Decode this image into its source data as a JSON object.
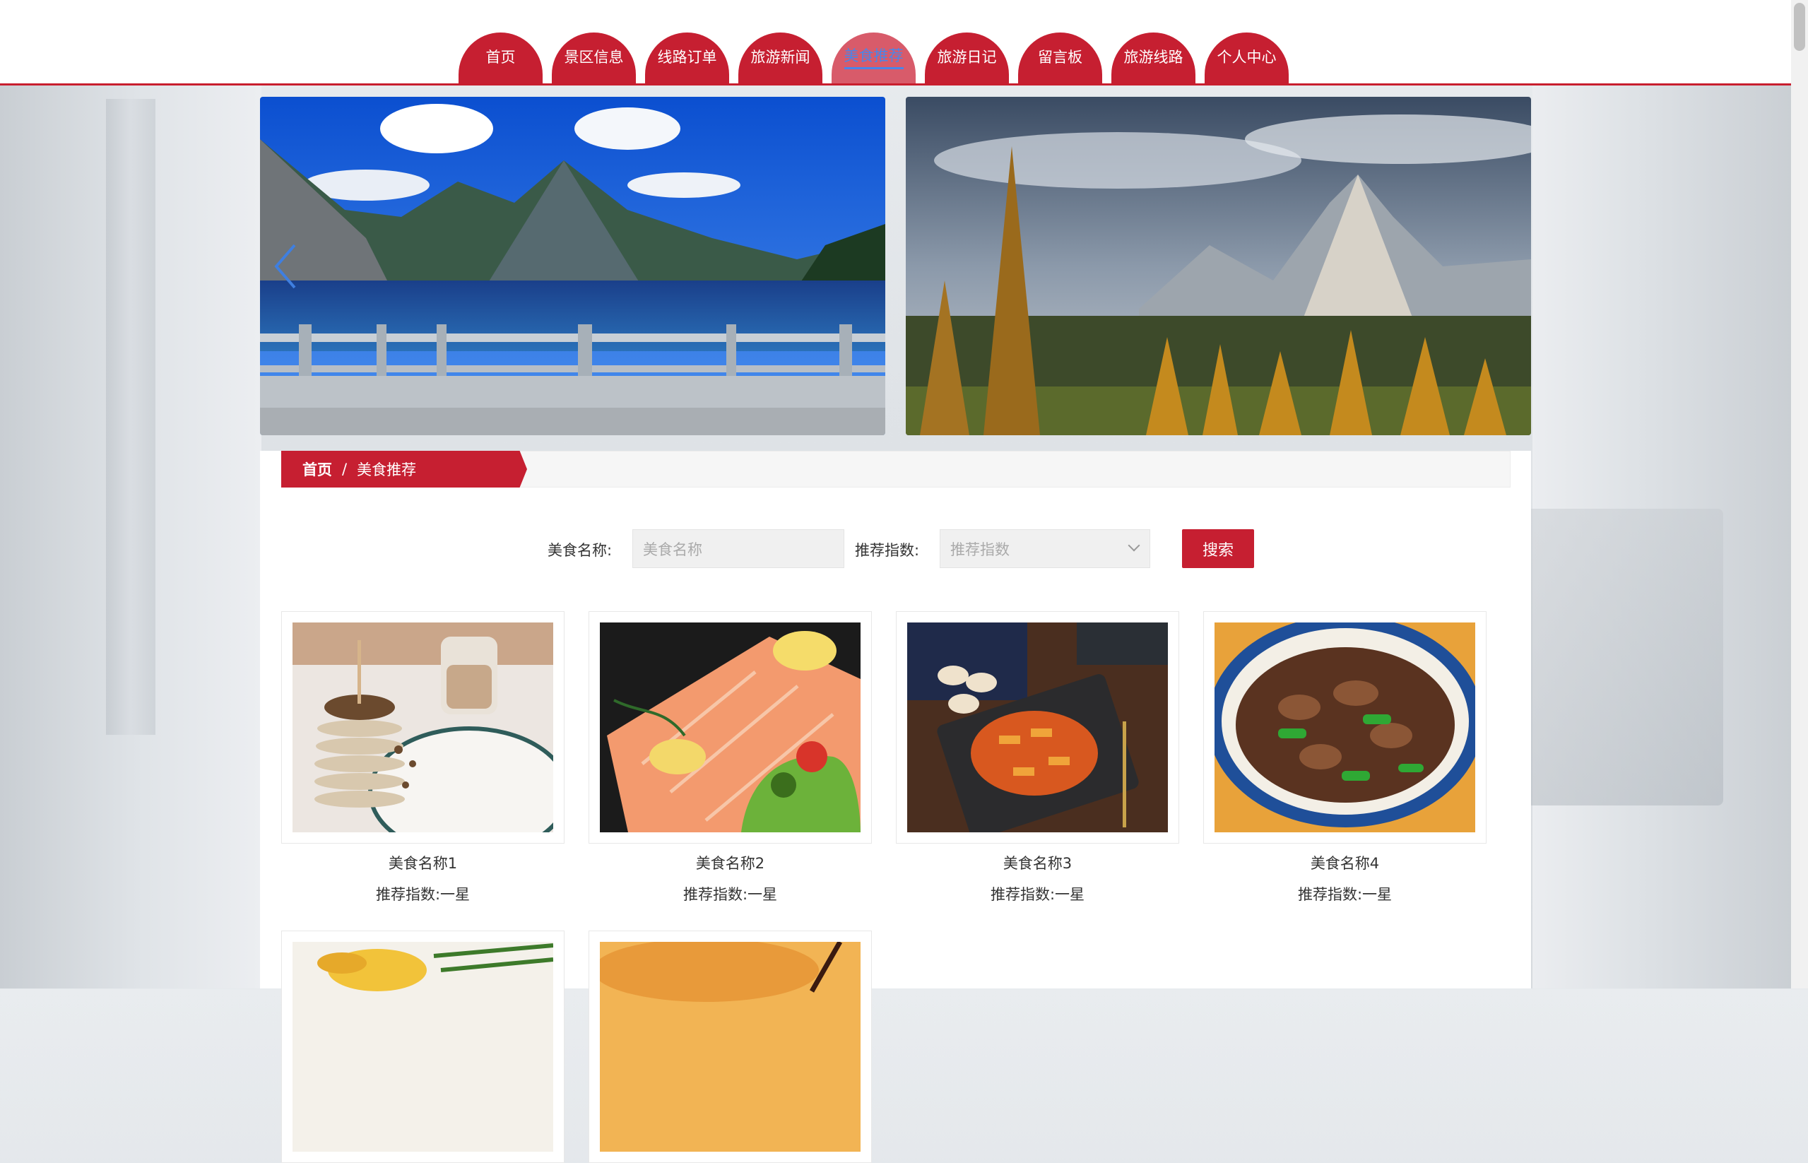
{
  "nav": {
    "items": [
      {
        "label": "首页"
      },
      {
        "label": "景区信息"
      },
      {
        "label": "线路订单"
      },
      {
        "label": "旅游新闻"
      },
      {
        "label": "美食推荐",
        "active": true
      },
      {
        "label": "旅游日记"
      },
      {
        "label": "留言板"
      },
      {
        "label": "旅游线路"
      },
      {
        "label": "个人中心"
      }
    ]
  },
  "breadcrumb": {
    "home": "首页",
    "separator": "/",
    "current": "美食推荐"
  },
  "search": {
    "name_label": "美食名称:",
    "name_placeholder": "美食名称",
    "rating_label": "推荐指数:",
    "rating_placeholder": "推荐指数",
    "button": "搜索"
  },
  "foods": [
    {
      "name": "美食名称1",
      "rating": "推荐指数:一星"
    },
    {
      "name": "美食名称2",
      "rating": "推荐指数:一星"
    },
    {
      "name": "美食名称3",
      "rating": "推荐指数:一星"
    },
    {
      "name": "美食名称4",
      "rating": "推荐指数:一星"
    }
  ],
  "colors": {
    "brand": "#c61f31",
    "active_text": "#4a86e8"
  }
}
